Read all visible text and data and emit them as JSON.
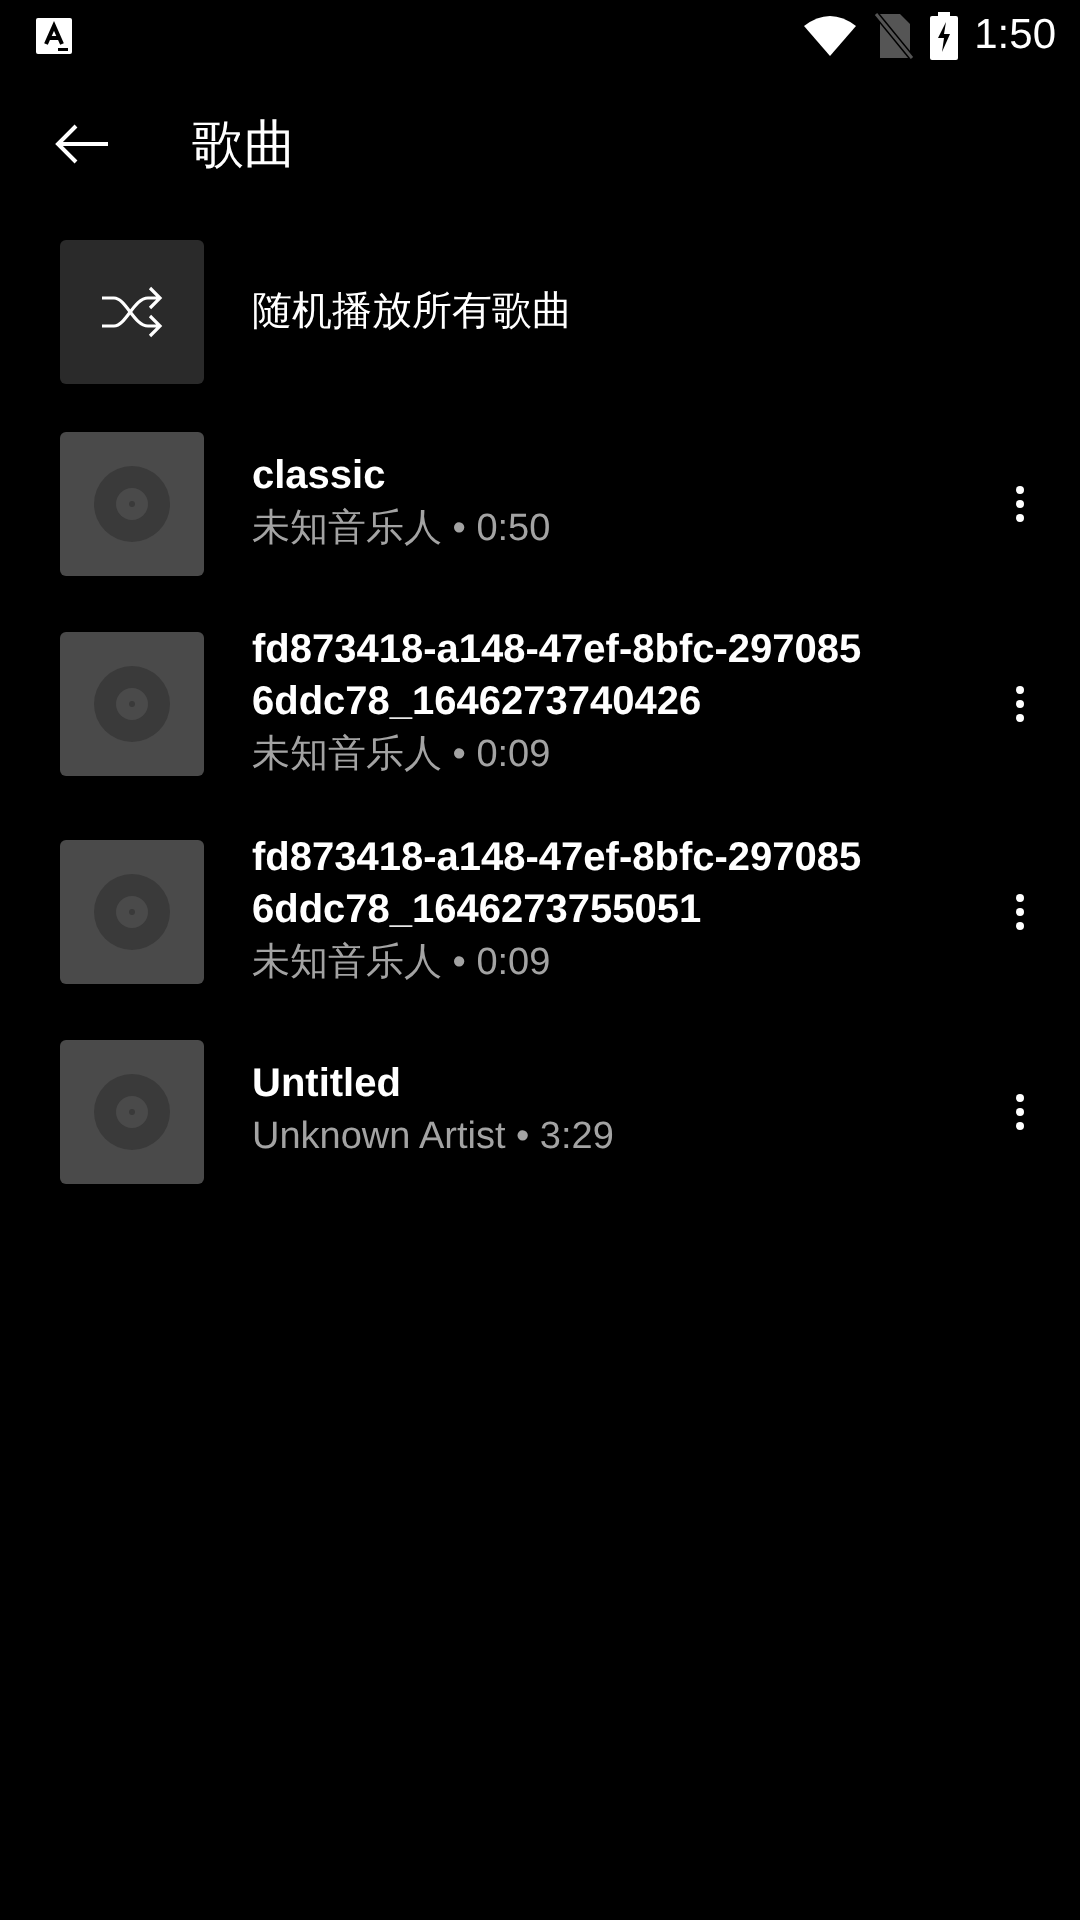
{
  "status_bar": {
    "time": "1:50"
  },
  "header": {
    "title": "歌曲"
  },
  "shuffle": {
    "label": "随机播放所有歌曲"
  },
  "songs": [
    {
      "title_lines": [
        "classic"
      ],
      "subtitle": "未知音乐人 • 0:50"
    },
    {
      "title_lines": [
        "fd873418-a148-47ef-8bfc-297085",
        "6ddc78_1646273740426"
      ],
      "subtitle": "未知音乐人 • 0:09"
    },
    {
      "title_lines": [
        "fd873418-a148-47ef-8bfc-297085",
        "6ddc78_1646273755051"
      ],
      "subtitle": "未知音乐人 • 0:09"
    },
    {
      "title_lines": [
        "Untitled"
      ],
      "subtitle": "Unknown Artist • 3:29"
    }
  ]
}
